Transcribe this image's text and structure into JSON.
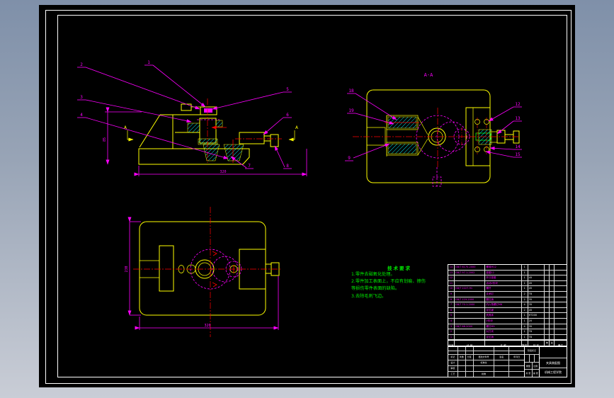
{
  "colors": {
    "outline": "#ffff00",
    "leader": "#ff00ff",
    "centerline": "#ff0000",
    "hatch": "#00ffff",
    "notes": "#00ff00",
    "frame": "#ffffff",
    "canvas": "#000000"
  },
  "views": {
    "front": {
      "balloons": [
        "1",
        "2",
        "3",
        "4",
        "5",
        "6",
        "7",
        "8"
      ],
      "section_letter": "A",
      "dim_height": "85",
      "dim_width": "320"
    },
    "section": {
      "title": "A-A",
      "balloons_left": [
        "18",
        "19",
        "9"
      ],
      "balloons_right": [
        "12",
        "13",
        "14",
        "15"
      ]
    },
    "plan": {
      "dim_height": "230",
      "dim_width": "320"
    }
  },
  "notes": {
    "title": "技术要求",
    "lines": [
      "1.零件去磁氧化处理。",
      "2.零件加工表面上，不应有划痕、擦伤",
      "等损伤零件表面的缺陷。",
      "3.去除毛刺飞边。"
    ]
  },
  "bom": {
    "header": {
      "no": "序号",
      "code": "代  号",
      "name": "名  称",
      "qty": "数量",
      "material": "材 料",
      "unit": "单件",
      "total": "总计",
      "weight": "重量",
      "remark": "备注"
    },
    "rows": [
      {
        "no": "14",
        "code": "GB/T 6170-2000",
        "name": "螺母M12",
        "qty": "1",
        "material": "",
        "remark": ""
      },
      {
        "no": "13",
        "code": "GB/T 97.1-2002",
        "name": "垫圈12",
        "qty": "1",
        "material": "",
        "remark": ""
      },
      {
        "no": "12",
        "code": "",
        "name": "开口垫圈",
        "qty": "1",
        "material": "45",
        "remark": ""
      },
      {
        "no": "11",
        "code": "",
        "name": "活动V形块",
        "qty": "1",
        "material": "45",
        "remark": ""
      },
      {
        "no": "10",
        "code": "GB/T 2227-91",
        "name": "螺杆",
        "qty": "1",
        "material": "45",
        "remark": ""
      },
      {
        "no": "9",
        "code": "",
        "name": "支承钉",
        "qty": "2",
        "material": "T8",
        "remark": ""
      },
      {
        "no": "8",
        "code": "GB/T 119-2000",
        "name": "圆柱销",
        "qty": "2",
        "material": "35",
        "remark": ""
      },
      {
        "no": "7",
        "code": "GB/T 70.1-2000",
        "name": "内六角螺钉M6",
        "qty": "4",
        "material": "35",
        "remark": ""
      },
      {
        "no": "6",
        "code": "",
        "name": "定位键",
        "qty": "2",
        "material": "45",
        "remark": ""
      },
      {
        "no": "5",
        "code": "",
        "name": "夹具体",
        "qty": "1",
        "material": "HT200",
        "remark": ""
      },
      {
        "no": "4",
        "code": "",
        "name": "V形块",
        "qty": "1",
        "material": "20",
        "remark": ""
      },
      {
        "no": "3",
        "code": "GB/T 68-2000",
        "name": "螺钉M5",
        "qty": "4",
        "material": "35",
        "remark": ""
      },
      {
        "no": "2",
        "code": "",
        "name": "对刀块",
        "qty": "1",
        "material": "T8",
        "remark": ""
      },
      {
        "no": "1",
        "code": "",
        "name": "定位销",
        "qty": "1",
        "material": "T8",
        "remark": ""
      }
    ]
  },
  "title_block": {
    "mark": "标记",
    "count": "处数",
    "zone": "分区",
    "change_doc": "更改文件号",
    "sign": "签名",
    "date": "年月日",
    "design": "设计",
    "standardize": "标准化",
    "stage_mark": "阶段标记",
    "weight": "重量",
    "scale": "比例",
    "audit": "审核",
    "process": "工艺",
    "approve": "批准",
    "sheets": "共 张",
    "sheet_no": "第 张",
    "drawing_name": "夹具装配图",
    "org": "机械工程学院"
  }
}
